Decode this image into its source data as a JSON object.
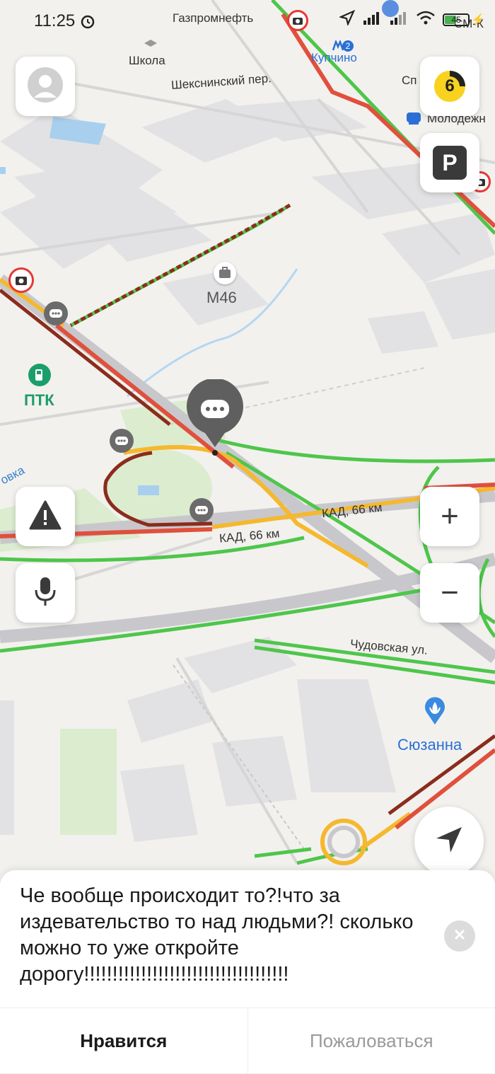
{
  "status_bar": {
    "time": "11:25",
    "battery": "45"
  },
  "map": {
    "labels": {
      "gazpromneft": "Газпромнефть",
      "school": "Школа",
      "kupchino": "Купчино",
      "metro_line": "2",
      "sheksninsky": "Шекснинский пер.",
      "moloden": "Молодёжн",
      "m46": "М46",
      "ptk": "ПТК",
      "ovka": "овка",
      "kad_upper": "КАД, 66 км",
      "kad_lower": "КАД, 66 км",
      "chudovskaya": "Чудовская ул.",
      "suzanna": "Сюзанна",
      "sportivnaya": "Сп",
      "smk": "СМ-К"
    },
    "colors": {
      "jam": "#e0503c",
      "heavy_jam": "#8b2c1c",
      "slow": "#f5b82e",
      "free": "#4ec64a"
    },
    "traffic_level": "6"
  },
  "controls": {
    "profile": "avatar-icon",
    "traffic": "traffic-score-icon",
    "parking": "P",
    "report": "warning-icon",
    "voice": "microphone-icon",
    "zoom_in": "+",
    "zoom_out": "−",
    "locate": "navigation-arrow-icon"
  },
  "comment": {
    "text": "Че вообще происходит то?!что за издевательство то над людьми?! сколько можно то уже откройте дорогу!!!!!!!!!!!!!!!!!!!!!!!!!!!!!!!!!!!!",
    "like_label": "Нравится",
    "report_label": "Пожаловаться"
  }
}
